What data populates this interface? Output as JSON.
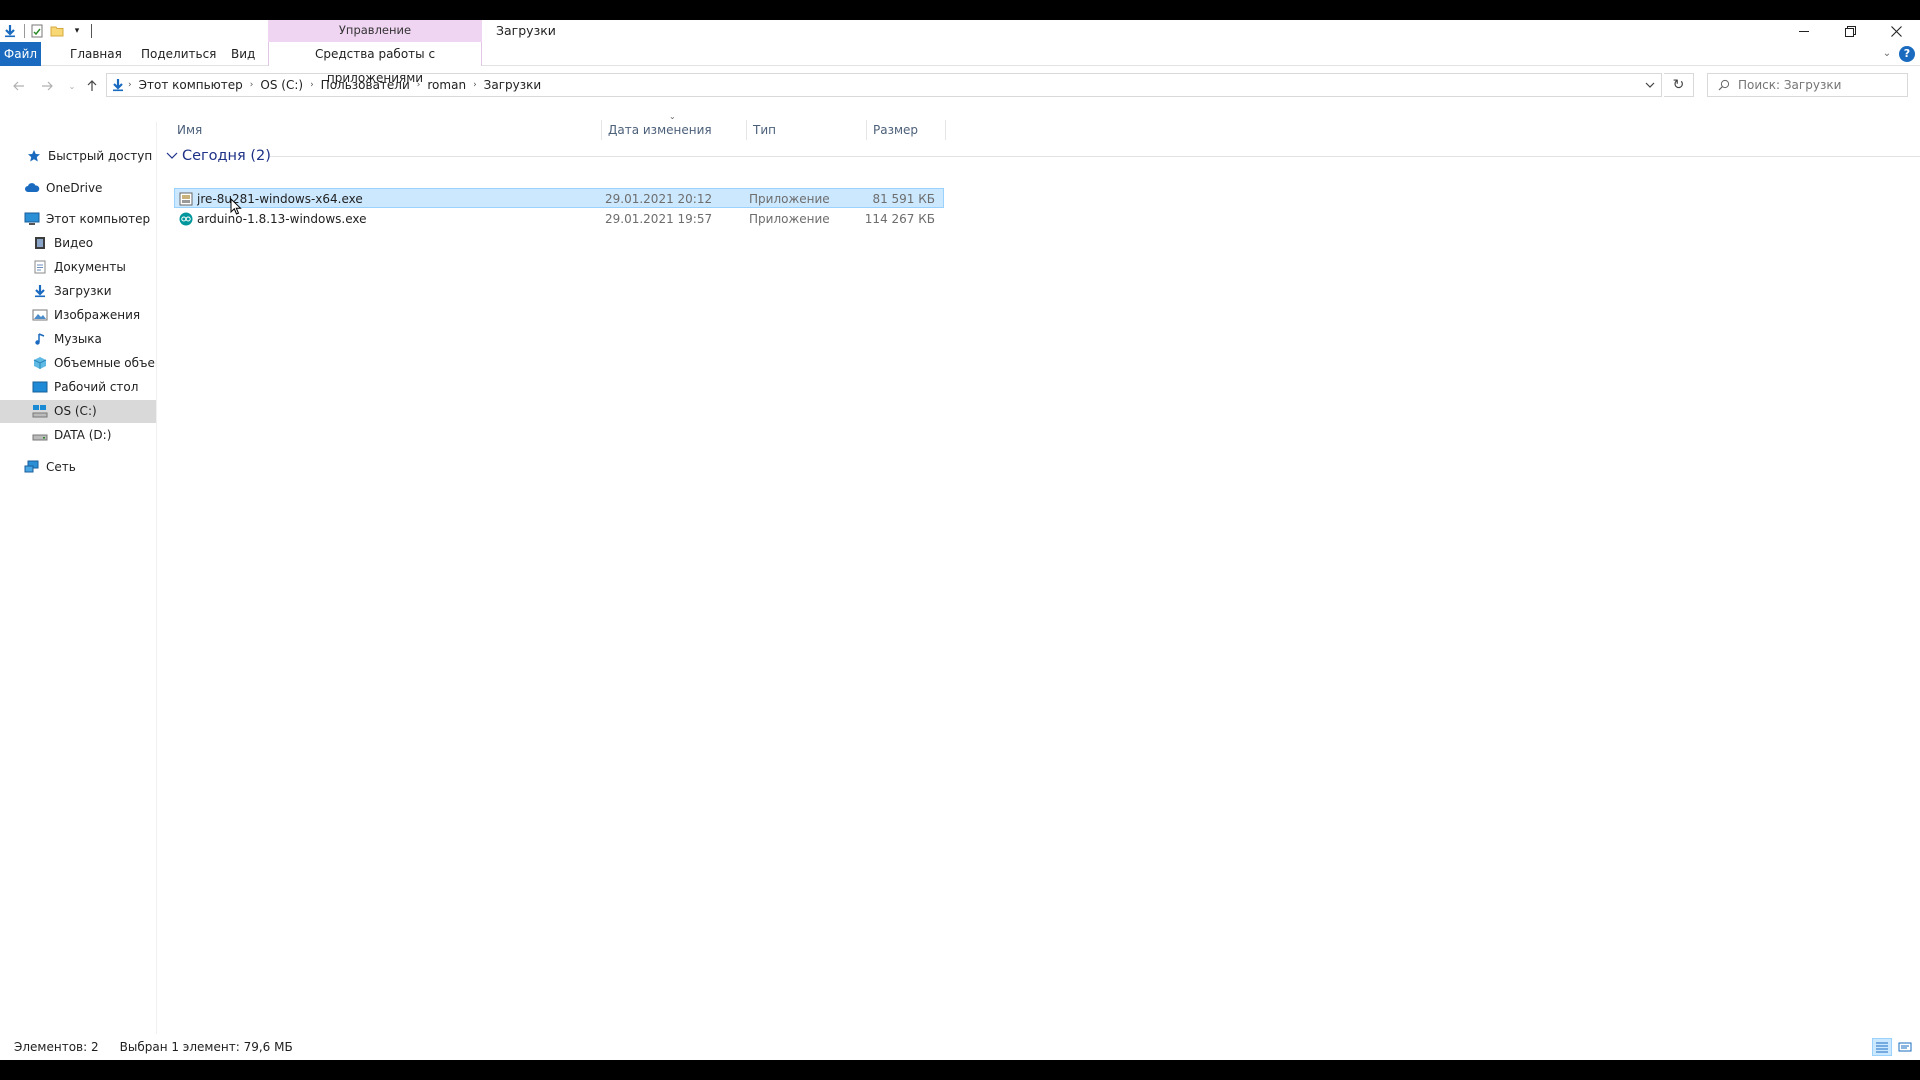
{
  "window": {
    "title": "Загрузки",
    "manage_label": "Управление"
  },
  "ribbon": {
    "tabs": [
      {
        "label": "Файл"
      },
      {
        "label": "Главная"
      },
      {
        "label": "Поделиться"
      },
      {
        "label": "Вид"
      },
      {
        "label": "Средства работы с приложениями"
      }
    ]
  },
  "address": {
    "crumbs": [
      "Этот компьютер",
      "OS (C:)",
      "Пользователи",
      "roman",
      "Загрузки"
    ]
  },
  "search": {
    "placeholder": "Поиск: Загрузки"
  },
  "nav": {
    "items": [
      {
        "label": "Быстрый доступ",
        "icon": "star-icon"
      },
      {
        "label": "OneDrive",
        "icon": "cloud-icon"
      },
      {
        "label": "Этот компьютер",
        "icon": "computer-icon"
      },
      {
        "label": "Видео",
        "icon": "video-icon"
      },
      {
        "label": "Документы",
        "icon": "document-icon"
      },
      {
        "label": "Загрузки",
        "icon": "download-icon"
      },
      {
        "label": "Изображения",
        "icon": "image-icon"
      },
      {
        "label": "Музыка",
        "icon": "music-icon"
      },
      {
        "label": "Объемные объекты",
        "icon": "cube-icon"
      },
      {
        "label": "Рабочий стол",
        "icon": "desktop-icon"
      },
      {
        "label": "OS (C:)",
        "icon": "drive-icon"
      },
      {
        "label": "DATA (D:)",
        "icon": "drive-icon"
      },
      {
        "label": "Сеть",
        "icon": "network-icon"
      }
    ],
    "selected": "OS (C:)"
  },
  "columns": {
    "name": "Имя",
    "date": "Дата изменения",
    "type": "Тип",
    "size": "Размер"
  },
  "group": {
    "label": "Сегодня (2)"
  },
  "files": [
    {
      "name": "jre-8u281-windows-x64.exe",
      "date": "29.01.2021 20:12",
      "type": "Приложение",
      "size": "81 591 КБ",
      "selected": true,
      "icon": "installer-icon"
    },
    {
      "name": "arduino-1.8.13-windows.exe",
      "date": "29.01.2021 19:57",
      "type": "Приложение",
      "size": "114 267 КБ",
      "selected": false,
      "icon": "arduino-icon"
    }
  ],
  "status": {
    "count": "Элементов: 2",
    "selection": "Выбран 1 элемент: 79,6 МБ"
  },
  "colors": {
    "accent": "#1a6bbf",
    "manage_tab": "#f0d5f3",
    "selection": "#cce8ff",
    "nav_selected": "#d9d9d9",
    "group_header": "#1e3287"
  }
}
